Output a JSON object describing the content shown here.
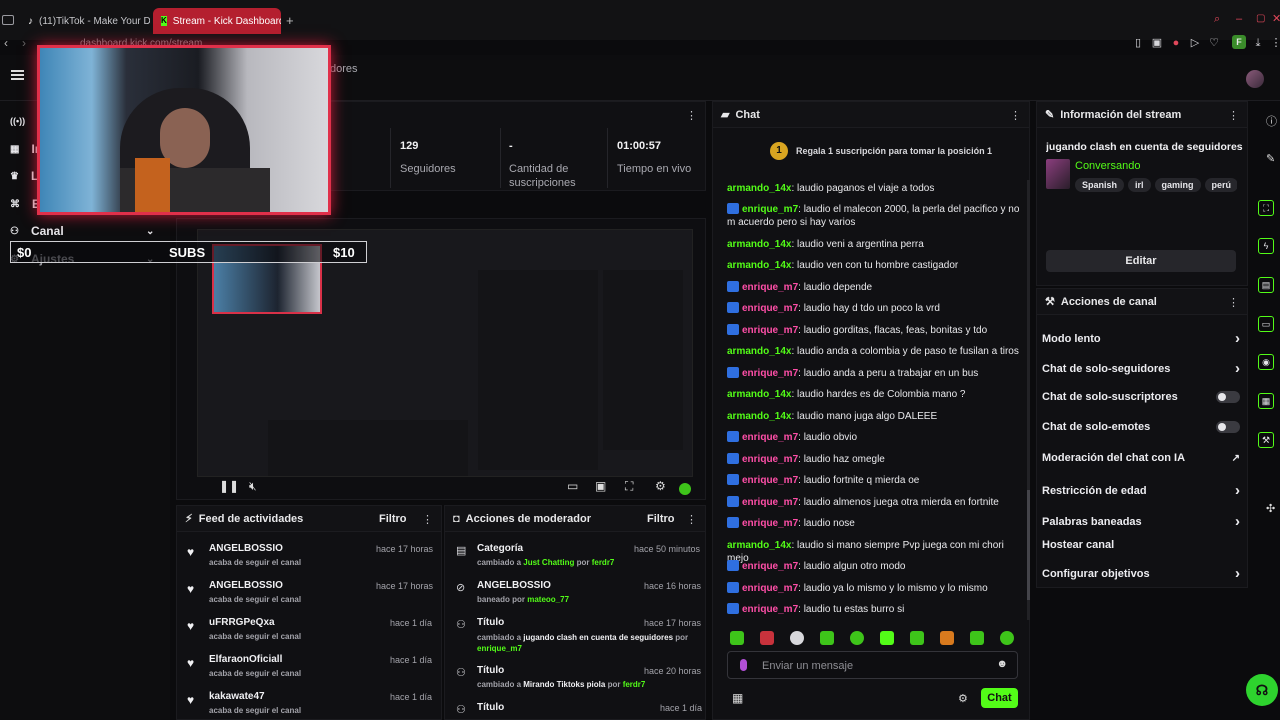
{
  "browser": {
    "tabs": [
      {
        "label": "(11)TikTok - Make Your Da"
      },
      {
        "label": "Stream - Kick Dashboard"
      }
    ],
    "url": "dashboard.kick.com/stream"
  },
  "sidebar": {
    "items": [
      {
        "label": "S"
      },
      {
        "label": "In"
      },
      {
        "label": "L"
      },
      {
        "label": "E"
      },
      {
        "label": "Canal"
      },
      {
        "label": "Ajustes"
      }
    ]
  },
  "overlay": {
    "left_amount": "$0",
    "subs_label": "SUBS",
    "right_amount": "$10"
  },
  "stats": {
    "items": [
      {
        "value": "",
        "label": "dores"
      },
      {
        "value": "129",
        "label": "Seguidores"
      },
      {
        "value": "-",
        "label": "Cantidad de suscripciones"
      },
      {
        "value": "01:00:57",
        "label": "Tiempo en vivo"
      }
    ]
  },
  "chat": {
    "title": "Chat",
    "pinned_text": "Regala 1 suscripción para tomar la posición 1",
    "pinned_position": "1",
    "messages": [
      {
        "user": "armando_14x",
        "color": "green",
        "badge": false,
        "text": ": laudio paganos el viaje a todos"
      },
      {
        "user": "enrique_m7",
        "color": "green",
        "badge": true,
        "text": ": laudio el malecon 2000, la perla del pacifico y no m acuerdo pero si hay varios"
      },
      {
        "user": "armando_14x",
        "color": "green",
        "badge": false,
        "text": ": laudio veni a argentina perra"
      },
      {
        "user": "armando_14x",
        "color": "green",
        "badge": false,
        "text": ": laudio ven con tu hombre castigador"
      },
      {
        "user": "enrique_m7",
        "color": "pink",
        "badge": true,
        "text": ": laudio depende"
      },
      {
        "user": "enrique_m7",
        "color": "pink",
        "badge": true,
        "text": ": laudio hay d tdo un poco la vrd"
      },
      {
        "user": "enrique_m7",
        "color": "pink",
        "badge": true,
        "text": ": laudio gorditas, flacas, feas, bonitas y tdo"
      },
      {
        "user": "armando_14x",
        "color": "green",
        "badge": false,
        "text": ": laudio anda a colombia y de paso te fusilan a tiros"
      },
      {
        "user": "enrique_m7",
        "color": "pink",
        "badge": true,
        "text": ": laudio anda a peru a trabajar en un bus"
      },
      {
        "user": "armando_14x",
        "color": "green",
        "badge": false,
        "text": ": laudio hardes es de Colombia mano ?"
      },
      {
        "user": "armando_14x",
        "color": "green",
        "badge": false,
        "text": ": laudio mano juga algo DALEEE"
      },
      {
        "user": "enrique_m7",
        "color": "pink",
        "badge": true,
        "text": ": laudio obvio"
      },
      {
        "user": "enrique_m7",
        "color": "pink",
        "badge": true,
        "text": ": laudio haz omegle"
      },
      {
        "user": "enrique_m7",
        "color": "pink",
        "badge": true,
        "text": ": laudio fortnite q mierda oe"
      },
      {
        "user": "enrique_m7",
        "color": "pink",
        "badge": true,
        "text": ": laudio almenos juega otra mierda en fortnite"
      },
      {
        "user": "enrique_m7",
        "color": "pink",
        "badge": true,
        "text": ": laudio nose"
      },
      {
        "user": "armando_14x",
        "color": "green",
        "badge": false,
        "text": ": laudio si mano siempre Pvp juega con mi chori mejo"
      },
      {
        "user": "enrique_m7",
        "color": "pink",
        "badge": true,
        "text": ": laudio algun otro modo"
      },
      {
        "user": "enrique_m7",
        "color": "pink",
        "badge": true,
        "text": ": laudio ya lo mismo y lo mismo y lo mismo"
      },
      {
        "user": "enrique_m7",
        "color": "pink",
        "badge": true,
        "text": ": laudio tu estas burro si"
      }
    ],
    "input_placeholder": "Enviar un mensaje",
    "send_label": "Chat"
  },
  "stream_info": {
    "title": "Información del stream",
    "stream_title": "jugando clash en cuenta de seguidores",
    "category": "Conversando",
    "tags": [
      "Spanish",
      "irl",
      "gaming",
      "perú"
    ],
    "edit_label": "Editar"
  },
  "channel_actions": {
    "title": "Acciones de canal",
    "items": [
      {
        "label": "Modo lento",
        "control": "chevron"
      },
      {
        "label": "Chat de solo-seguidores",
        "control": "chevron"
      },
      {
        "label": "Chat de solo-suscriptores",
        "control": "toggle"
      },
      {
        "label": "Chat de solo-emotes",
        "control": "toggle"
      },
      {
        "label": "Moderación del chat con IA",
        "control": "external"
      },
      {
        "label": "Restricción de edad",
        "control": "chevron"
      },
      {
        "label": "Palabras baneadas",
        "control": "chevron"
      },
      {
        "label": "Hostear canal",
        "control": "none"
      },
      {
        "label": "Configurar objetivos",
        "control": "chevron"
      }
    ]
  },
  "activity_feed": {
    "title": "Feed de actividades",
    "filter_label": "Filtro",
    "items": [
      {
        "name": "ANGELBOSSIO",
        "sub": "acaba de seguir el canal",
        "time": "hace 17 horas"
      },
      {
        "name": "ANGELBOSSIO",
        "sub": "acaba de seguir el canal",
        "time": "hace 17 horas"
      },
      {
        "name": "uFRRGPeQxa",
        "sub": "acaba de seguir el canal",
        "time": "hace 1 día"
      },
      {
        "name": "ElfaraonOficiall",
        "sub": "acaba de seguir el canal",
        "time": "hace 1 día"
      },
      {
        "name": "kakawate47",
        "sub": "acaba de seguir el canal",
        "time": "hace 1 día"
      }
    ]
  },
  "mod_actions": {
    "title": "Acciones de moderador",
    "filter_label": "Filtro",
    "items": [
      {
        "title": "Categoría",
        "pre": "cambiado a ",
        "hl": "Just Chatting",
        "mid": " por ",
        "user": "ferdr7",
        "time": "hace 50 minutos"
      },
      {
        "title": "ANGELBOSSIO",
        "pre": "baneado por ",
        "hl": "",
        "mid": "",
        "user": "mateoo_77",
        "time": "hace 16 horas"
      },
      {
        "title": "Título",
        "pre": "cambiado a ",
        "hl": "jugando clash en cuenta de seguidores",
        "mid": " por ",
        "user": "enrique_m7",
        "time": "hace 17 horas"
      },
      {
        "title": "Título",
        "pre": "cambiado a ",
        "hl": "Mirando Tiktoks piola",
        "mid": " por ",
        "user": "ferdr7",
        "time": "hace 20 horas"
      },
      {
        "title": "Título",
        "pre": "",
        "hl": "",
        "mid": "",
        "user": "",
        "time": "hace 1 día"
      }
    ]
  },
  "colors": {
    "kick_green": "#53fc18",
    "pink_user": "#ff4fa8",
    "active_tab": "#b41f2f"
  }
}
